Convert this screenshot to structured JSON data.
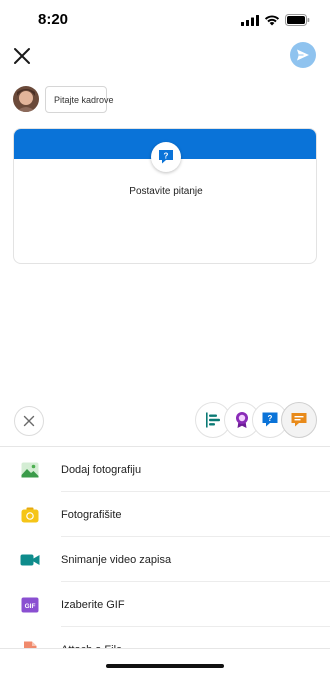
{
  "status_bar": {
    "time": "8:20"
  },
  "composer": {
    "audience_label": "Pitajte kadrove",
    "question_prompt": "Postavite pitanje"
  },
  "post_types": [
    {
      "icon": "poll-icon",
      "color": "#0b7a75"
    },
    {
      "icon": "praise-icon",
      "color": "#8a2bb8"
    },
    {
      "icon": "question-icon",
      "color": "#0a73d8"
    },
    {
      "icon": "discussion-icon",
      "color": "#e88a1a",
      "selected": true
    }
  ],
  "attachments": [
    {
      "icon": "photo-icon",
      "label": "Dodaj fotografiju"
    },
    {
      "icon": "camera-icon",
      "label": "Fotografišite"
    },
    {
      "icon": "video-icon",
      "label": "Snimanje video zapisa"
    },
    {
      "icon": "gif-icon",
      "label": "Izaberite GIF"
    },
    {
      "icon": "file-icon",
      "label": "Attach a File"
    }
  ],
  "colors": {
    "accent": "#0a73d8",
    "send_disabled": "#8fc3ef"
  }
}
